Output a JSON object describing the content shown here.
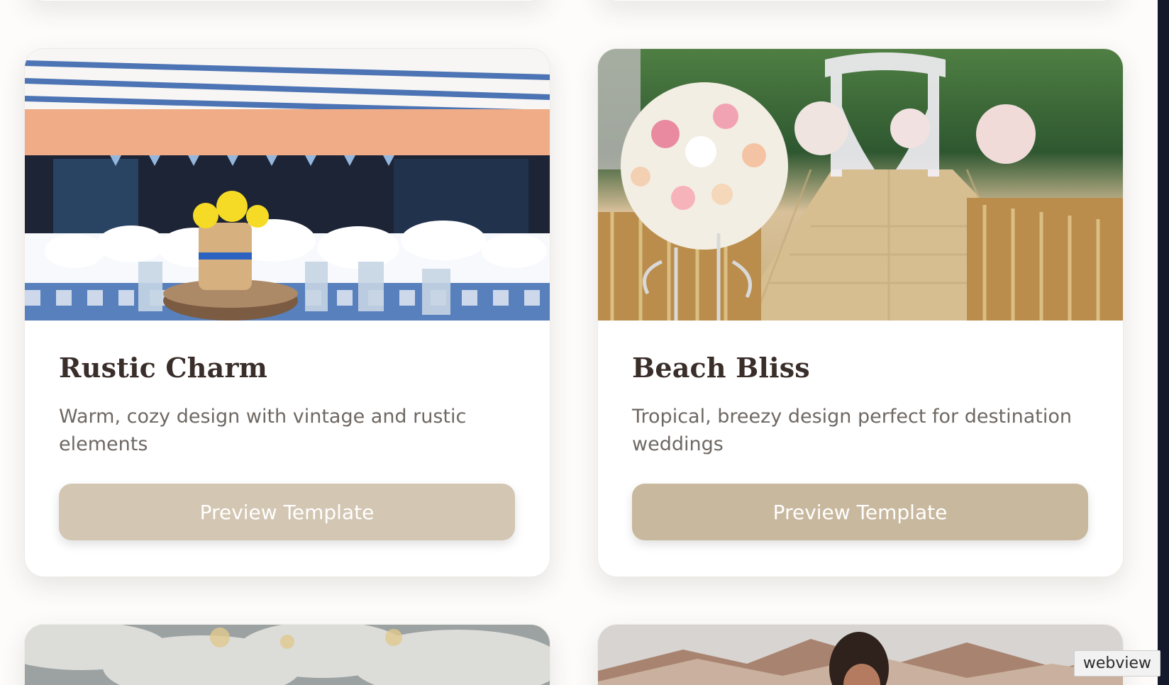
{
  "cards": [
    {
      "title": "Rustic Charm",
      "description": "Warm, cozy design with vintage and rustic elements",
      "button_label": "Preview Template"
    },
    {
      "title": "Beach Bliss",
      "description": "Tropical, breezy design perfect for destination weddings",
      "button_label": "Preview Template"
    }
  ],
  "badge": {
    "label": "webview"
  }
}
